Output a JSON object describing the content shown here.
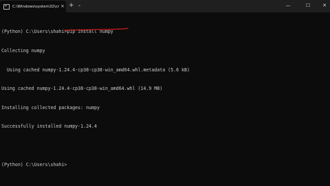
{
  "window": {
    "tab_title": "C:\\Windows\\system32\\cmd.e",
    "tab_close_glyph": "×",
    "new_tab_glyph": "+",
    "dropdown_glyph": "⌄",
    "minimize_glyph": "—",
    "maximize_glyph": "☐",
    "close_glyph": "✕"
  },
  "console": {
    "prompt1": "(Python) C:\\Users\\shahi>",
    "command1": "pip install numpy",
    "lines": [
      "Collecting numpy",
      "  Using cached numpy-1.24.4-cp38-cp38-win_amd64.whl.metadata (5.6 kB)",
      "Using cached numpy-1.24.4-cp38-cp38-win_amd64.whl (14.9 MB)",
      "Installing collected packages: numpy",
      "Successfully installed numpy-1.24.4"
    ],
    "prompt2": "(Python) C:\\Users\\shahi>"
  },
  "colors": {
    "background": "#0c0c0c",
    "text": "#cccccc",
    "annotation": "#d41e1e"
  },
  "icons": [
    "terminal-icon",
    "close-icon",
    "plus-icon",
    "chevron-down-icon",
    "minimize-icon",
    "maximize-icon",
    "window-close-icon"
  ]
}
